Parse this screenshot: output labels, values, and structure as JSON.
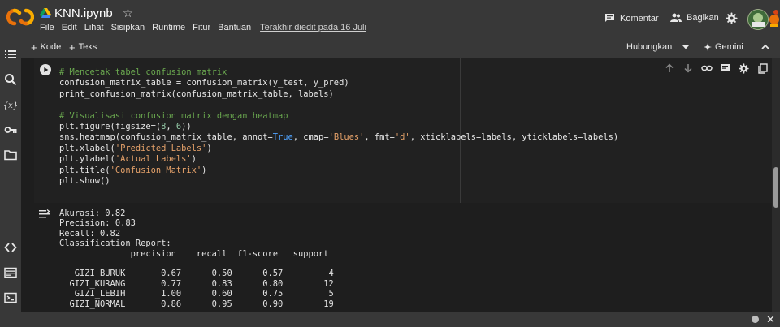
{
  "app": {
    "file_title": "KNN.ipynb",
    "menu": [
      "File",
      "Edit",
      "Lihat",
      "Sisipkan",
      "Runtime",
      "Fitur",
      "Bantuan"
    ],
    "last_edit": "Terakhir diedit pada 16 Juli",
    "comment_label": "Komentar",
    "share_label": "Bagikan"
  },
  "toolbar": {
    "add_code": "Kode",
    "add_text": "Teks",
    "connect": "Hubungkan",
    "gemini": "Gemini"
  },
  "cell": {
    "code_lines": [
      "# Mencetak tabel confusion matrix",
      "confusion_matrix_table = confusion_matrix(y_test, y_pred)",
      "print_confusion_matrix(confusion_matrix_table, labels)",
      "",
      "# Visualisasi confusion matrix dengan heatmap",
      "plt.figure(figsize=(8, 6))",
      "sns.heatmap(confusion_matrix_table, annot=True, cmap='Blues', fmt='d', xticklabels=labels, yticklabels=labels)",
      "plt.xlabel('Predicted Labels')",
      "plt.ylabel('Actual Labels')",
      "plt.title('Confusion Matrix')",
      "plt.show()"
    ]
  },
  "output": {
    "lines": [
      "Akurasi: 0.82",
      "Precision: 0.83",
      "Recall: 0.82",
      "Classification Report:",
      "              precision    recall  f1-score   support",
      "",
      "   GIZI_BURUK       0.67      0.50      0.57         4",
      "  GIZI_KURANG       0.77      0.83      0.80        12",
      "   GIZI_LEBIH       1.00      0.60      0.75         5",
      "  GIZI_NORMAL       0.86      0.95      0.90        19"
    ]
  },
  "icons": {
    "sidebar": [
      "toc-icon",
      "search-icon",
      "variables-icon",
      "secrets-key-icon",
      "files-folder-icon",
      "code-snippets-icon",
      "command-palette-icon",
      "terminal-icon"
    ],
    "cell_toolbar": [
      "move-up-icon",
      "move-down-icon",
      "link-icon",
      "comment-icon",
      "settings-icon",
      "mirror-cell-icon",
      "delete-icon",
      "more-vert-icon"
    ]
  },
  "colors": {
    "logo_orange": "#f9ab00",
    "logo_orange_dark": "#e8710a",
    "comment_green": "#6aa84f",
    "string_orange": "#e6a26a",
    "keyword_blue": "#4fa3ff"
  }
}
